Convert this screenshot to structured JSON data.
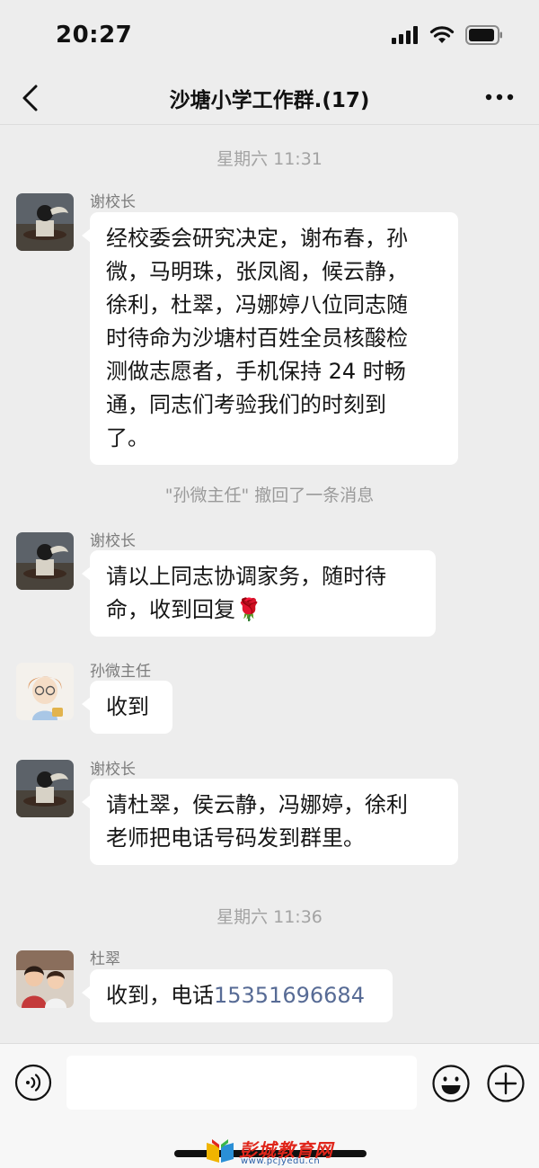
{
  "status_bar": {
    "time": "20:27"
  },
  "header": {
    "title": "沙塘小学工作群.(17)"
  },
  "timestamps": [
    "星期六 11:31",
    "星期六 11:36"
  ],
  "recall_notice": "\"孙微主任\" 撤回了一条消息",
  "messages": [
    {
      "sender": "谢校长",
      "lines": [
        "经校委会研究决定，谢布春，孙",
        "微，马明珠，张凤阁，候云静，",
        "徐利，杜翠，冯娜婷八位同志随",
        "时待命为沙塘村百姓全员核酸检",
        "测做志愿者，手机保持 24 时畅",
        "通，同志们考验我们的时刻到",
        "了。"
      ]
    },
    {
      "sender": "谢校长",
      "lines": [
        "请以上同志协调家务，随时待",
        "命，收到回复🌹"
      ]
    },
    {
      "sender": "孙微主任",
      "lines": [
        "收到"
      ]
    },
    {
      "sender": "谢校长",
      "lines": [
        "请杜翠，侯云静，冯娜婷，徐利",
        "老师把电话号码发到群里。"
      ]
    },
    {
      "sender": "杜翠",
      "prefix": "收到，电话",
      "phone": "15351696684"
    }
  ],
  "watermark": {
    "name": "彭城教育网",
    "url": "www.pcjyedu.cn"
  }
}
